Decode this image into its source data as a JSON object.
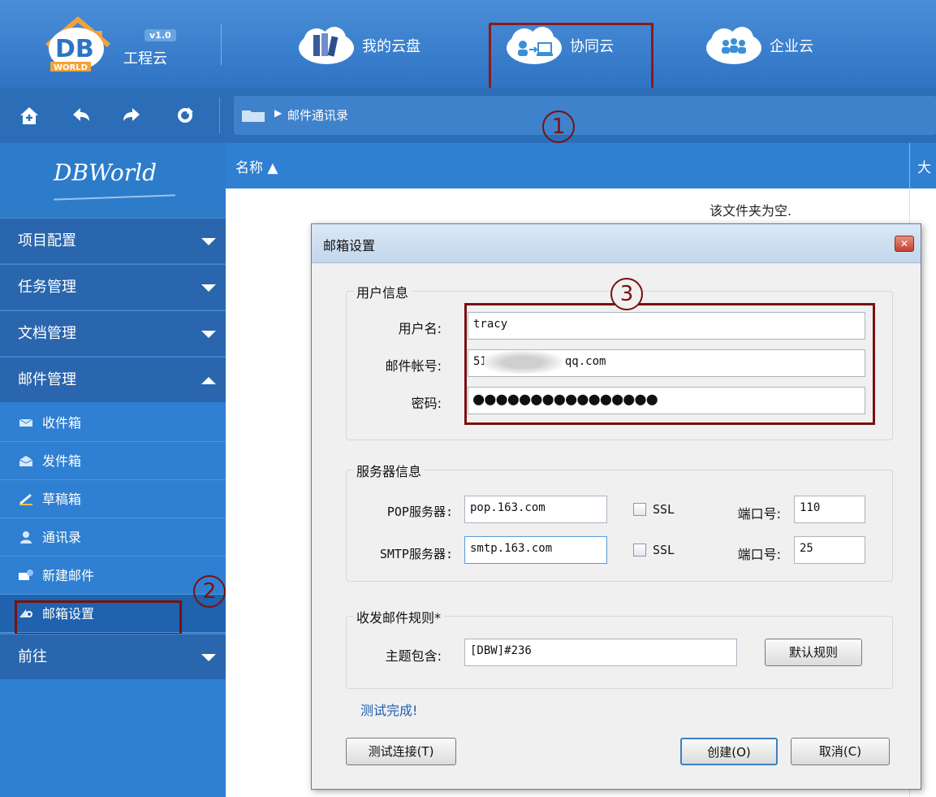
{
  "app": {
    "logo_text": "DB",
    "logo_sub": "WORLD",
    "version": "v1.0",
    "name": "工程云"
  },
  "top_tabs": [
    {
      "label": "我的云盘",
      "icon": "bookshelf-cloud-icon"
    },
    {
      "label": "协同云",
      "icon": "sync-cloud-icon"
    },
    {
      "label": "企业云",
      "icon": "people-cloud-icon"
    }
  ],
  "breadcrumb": {
    "path": "邮件通讯录"
  },
  "annotations": {
    "one": "1",
    "two": "2",
    "three": "3"
  },
  "sidebar": {
    "brand": "DBWorld",
    "groups": [
      "项目配置",
      "任务管理",
      "文档管理",
      "邮件管理",
      "前往"
    ],
    "mail_items": [
      {
        "label": "收件箱",
        "icon": "inbox-icon"
      },
      {
        "label": "发件箱",
        "icon": "outbox-icon"
      },
      {
        "label": "草稿箱",
        "icon": "draft-icon"
      },
      {
        "label": "通讯录",
        "icon": "contacts-icon"
      },
      {
        "label": "新建邮件",
        "icon": "new-mail-icon"
      },
      {
        "label": "邮箱设置",
        "icon": "mail-settings-icon"
      }
    ]
  },
  "file_list": {
    "col_name": "名称 ▲",
    "col_size": "大",
    "empty_text": "该文件夹为空."
  },
  "dialog": {
    "title": "邮箱设置",
    "user_group": "用户信息",
    "username_label": "用户名:",
    "username_value": "tracy",
    "account_label": "邮件帐号:",
    "account_value_prefix": "51",
    "account_value_suffix": "qq.com",
    "password_label": "密码:",
    "password_value": "●●●●●●●●●●●●●●●●",
    "server_group": "服务器信息",
    "pop_label": "POP服务器:",
    "pop_value": "pop.163.com",
    "smtp_label": "SMTP服务器:",
    "smtp_value": "smtp.163.com",
    "ssl_label": "SSL",
    "port_label": "端口号:",
    "pop_port": "110",
    "smtp_port": "25",
    "rule_group": "收发邮件规则*",
    "subject_label": "主题包含:",
    "subject_value": "[DBW]#236",
    "default_rule_button": "默认规则",
    "status_text": "测试完成!",
    "test_button": "测试连接(T)",
    "create_button": "创建(O)",
    "cancel_button": "取消(C)"
  },
  "colors": {
    "topbar": "#3b82d0",
    "sidebar": "#2f80d2",
    "sidebar_group": "#2a66ad",
    "annotation": "#7a1010"
  }
}
